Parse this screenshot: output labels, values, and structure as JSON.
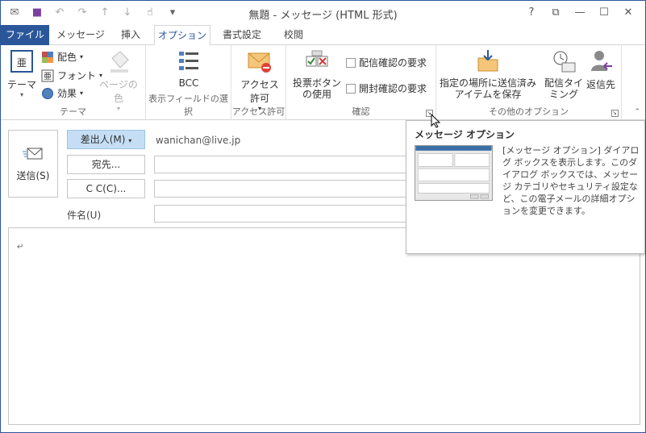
{
  "window": {
    "title": "無題 - メッセージ (HTML 形式)",
    "controls": [
      "?",
      "⧉",
      "—",
      "☐",
      "✕"
    ]
  },
  "tabs": [
    {
      "label": "ファイル"
    },
    {
      "label": "メッセージ"
    },
    {
      "label": "挿入"
    },
    {
      "label": "オプション"
    },
    {
      "label": "書式設定"
    },
    {
      "label": "校閲"
    }
  ],
  "ribbon": {
    "theme_group": {
      "label": "テーマ",
      "theme_button": "テーマ",
      "colors": "配色",
      "fonts": "フォント",
      "effects": "効果",
      "page_color": "ページの色"
    },
    "fields_group": {
      "label": "表示フィールドの選択",
      "bcc": "BCC"
    },
    "permission_group": {
      "label": "アクセス許可",
      "button": "アクセス許可"
    },
    "tracking_group": {
      "label": "確認",
      "voting": "投票ボタンの使用",
      "request_delivery": "配信確認の要求",
      "request_read": "開封確認の要求"
    },
    "more_group": {
      "label": "その他のオプション",
      "save_sent": "指定の場所に送信済みアイテムを保存",
      "delay": "配信タイミング",
      "reply_to": "返信先"
    }
  },
  "form": {
    "send": "送信(S)",
    "from_button": "差出人(M)",
    "from_value": "wanichan@live.jp",
    "to_button": "宛先...",
    "cc_button": "C C(C)...",
    "subject_label": "件名(U)",
    "body_mark": "↵"
  },
  "tooltip": {
    "title": "メッセージ オプション",
    "text": "[メッセージ オプション] ダイアログ ボックスを表示します。このダイアログ ボックスでは、メッセージ カテゴリやセキュリティ設定など、この電子メールの詳細オプションを変更できます。"
  },
  "colors": {
    "file_tab": "#2b579a",
    "from_button_bg": "#c5def5"
  }
}
